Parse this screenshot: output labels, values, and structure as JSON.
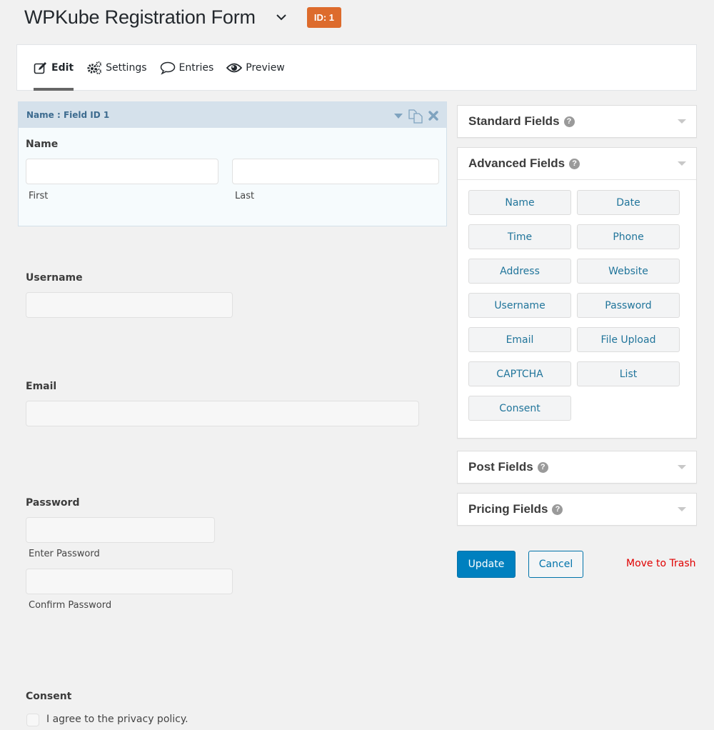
{
  "header": {
    "title": "WPKube Registration Form",
    "id_badge": "ID: 1",
    "badge_color": "#dd6b2c"
  },
  "tabs": [
    {
      "label": "Edit",
      "icon": "edit-icon",
      "active": true
    },
    {
      "label": "Settings",
      "icon": "gears-icon",
      "active": false
    },
    {
      "label": "Entries",
      "icon": "comment-icon",
      "active": false
    },
    {
      "label": "Preview",
      "icon": "eye-icon",
      "active": false
    }
  ],
  "selected_field": {
    "bar_title": "Name : Field ID 1",
    "label": "Name",
    "first_sublabel": "First",
    "last_sublabel": "Last",
    "first_value": "",
    "last_value": ""
  },
  "form": {
    "username": {
      "label": "Username",
      "value": ""
    },
    "email": {
      "label": "Email",
      "value": ""
    },
    "password": {
      "label": "Password",
      "enter_sublabel": "Enter Password",
      "confirm_sublabel": "Confirm Password"
    },
    "consent": {
      "label": "Consent",
      "checkbox_text": "I agree to the privacy policy.",
      "checked": false
    }
  },
  "sidebar": {
    "standard": {
      "title": "Standard Fields",
      "help": "?"
    },
    "advanced": {
      "title": "Advanced Fields",
      "help": "?",
      "buttons": [
        "Name",
        "Date",
        "Time",
        "Phone",
        "Address",
        "Website",
        "Username",
        "Password",
        "Email",
        "File Upload",
        "CAPTCHA",
        "List",
        "Consent"
      ]
    },
    "post": {
      "title": "Post Fields",
      "help": "?"
    },
    "pricing": {
      "title": "Pricing Fields",
      "help": "?"
    }
  },
  "actions": {
    "update": "Update",
    "cancel": "Cancel",
    "trash": "Move to Trash",
    "primary_color": "#0080bf",
    "trash_color": "#e00000"
  }
}
